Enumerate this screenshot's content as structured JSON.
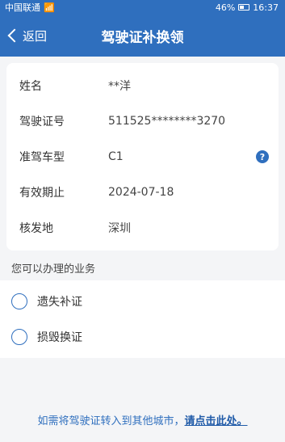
{
  "status_bar": {
    "carrier": "中国联通",
    "battery": "46%",
    "time": "16:37"
  },
  "nav": {
    "back_label": "返回",
    "title": "驾驶证补换领"
  },
  "license_info": [
    {
      "label": "姓名",
      "value": "**洋"
    },
    {
      "label": "驾驶证号",
      "value": "511525********3270"
    },
    {
      "label": "准驾车型",
      "value": "C1"
    },
    {
      "label": "有效期止",
      "value": "2024-07-18"
    },
    {
      "label": "核发地",
      "value": "深圳"
    }
  ],
  "help_icon": "?",
  "services_title": "您可以办理的业务",
  "options": [
    {
      "label": "遗失补证"
    },
    {
      "label": "损毁换证"
    }
  ],
  "footer": {
    "prefix": "如需将驾驶证转入到其他城市，",
    "link": "请点击此处。"
  },
  "colors": {
    "accent": "#2f6fbe",
    "background": "#f4f5f7"
  }
}
